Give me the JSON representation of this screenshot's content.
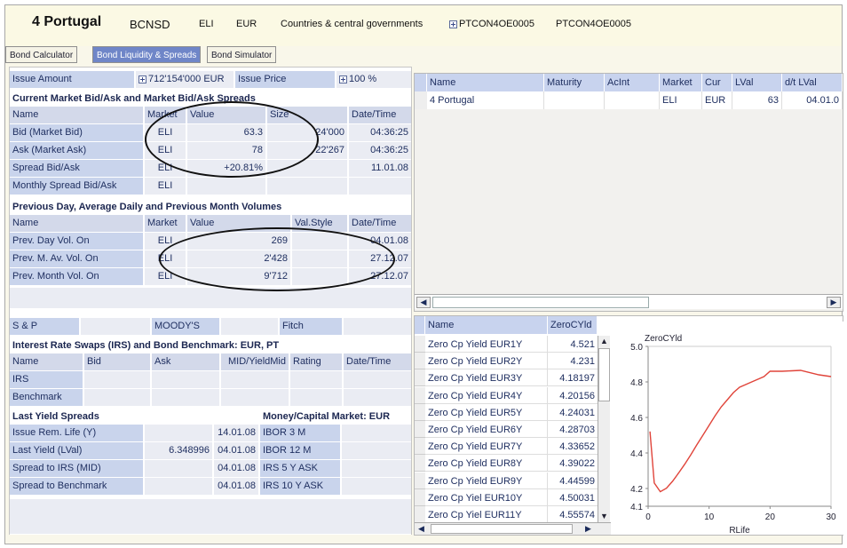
{
  "header": {
    "name": "4 Portugal",
    "issuer_code": "BCNSD",
    "market": "ELI",
    "currency": "EUR",
    "sector": "Countries & central governments",
    "isin1": "PTCON4OE0005",
    "isin2": "PTCON4OE0005"
  },
  "tabs": [
    "Bond Calculator",
    "Bond Liquidity & Spreads",
    "Bond Simulator"
  ],
  "issue": {
    "amount_label": "Issue Amount",
    "amount_value": "712'154'000 EUR",
    "price_label": "Issue Price",
    "price_value": "100 %"
  },
  "bidask": {
    "title": "Current Market Bid/Ask and Market Bid/Ask Spreads",
    "headers": [
      "Name",
      "Market",
      "Value",
      "Size",
      "Date/Time"
    ],
    "rows": [
      {
        "name": "Bid (Market Bid)",
        "market": "ELI",
        "value": "63.3",
        "size": "24'000",
        "time": "04:36:25"
      },
      {
        "name": "Ask (Market Ask)",
        "market": "ELI",
        "value": "78",
        "size": "22'267",
        "time": "04:36:25"
      },
      {
        "name": "Spread Bid/Ask",
        "market": "ELI",
        "value": "+20.81%",
        "size": "",
        "time": "11.01.08"
      },
      {
        "name": "Monthly Spread Bid/Ask",
        "market": "ELI",
        "value": "",
        "size": "",
        "time": ""
      }
    ]
  },
  "volumes": {
    "title": "Previous Day, Average Daily and Previous Month Volumes",
    "headers": [
      "Name",
      "Market",
      "Value",
      "Val.Style",
      "Date/Time"
    ],
    "rows": [
      {
        "name": "Prev. Day Vol. On",
        "market": "ELI",
        "value": "269",
        "time": "04.01.08"
      },
      {
        "name": "Prev. M. Av. Vol. On",
        "market": "ELI",
        "value": "2'428",
        "time": "27.12.07"
      },
      {
        "name": "Prev. Month Vol. On",
        "market": "ELI",
        "value": "9'712",
        "time": "27.12.07"
      }
    ]
  },
  "ratings": {
    "sp": "S & P",
    "moodys": "MOODY'S",
    "fitch": "Fitch"
  },
  "irs": {
    "title": "Interest Rate Swaps (IRS) and Bond Benchmark: EUR, PT",
    "headers": [
      "Name",
      "Bid",
      "Ask",
      "MID/YieldMid",
      "Rating",
      "Date/Time"
    ],
    "rows": [
      "IRS",
      "Benchmark"
    ]
  },
  "yields": {
    "title": "Last Yield Spreads",
    "mm_title": "Money/Capital Market: EUR",
    "rows": [
      {
        "name": "Issue Rem. Life (Y)",
        "value": "",
        "date": "14.01.08",
        "mm": "IBOR 3 M"
      },
      {
        "name": "Last Yield (LVal)",
        "value": "6.348996",
        "date": "04.01.08",
        "mm": "IBOR 12 M"
      },
      {
        "name": "Spread to IRS (MID)",
        "value": "",
        "date": "04.01.08",
        "mm": "IRS 5 Y ASK"
      },
      {
        "name": "Spread to Benchmark",
        "value": "",
        "date": "04.01.08",
        "mm": "IRS 10 Y ASK"
      }
    ]
  },
  "grid_top": {
    "headers": [
      "Name",
      "Maturity",
      "AcInt",
      "Market",
      "Cur",
      "LVal",
      "d/t LVal"
    ],
    "row": {
      "name": "4 Portugal",
      "maturity": "",
      "acint": "",
      "market": "ELI",
      "cur": "EUR",
      "lval": "63",
      "dt": "04.01.0"
    }
  },
  "grid_yield": {
    "headers": [
      "Name",
      "ZeroCYld"
    ],
    "rows": [
      {
        "name": "Zero Cp Yield EUR1Y",
        "value": "4.521"
      },
      {
        "name": "Zero Cp Yield EUR2Y",
        "value": "4.231"
      },
      {
        "name": "Zero Cp Yield EUR3Y",
        "value": "4.18197"
      },
      {
        "name": "Zero Cp Yield EUR4Y",
        "value": "4.20156"
      },
      {
        "name": "Zero Cp Yield EUR5Y",
        "value": "4.24031"
      },
      {
        "name": "Zero Cp Yield EUR6Y",
        "value": "4.28703"
      },
      {
        "name": "Zero Cp Yield EUR7Y",
        "value": "4.33652"
      },
      {
        "name": "Zero Cp Yield EUR8Y",
        "value": "4.39022"
      },
      {
        "name": "Zero Cp Yield EUR9Y",
        "value": "4.44599"
      },
      {
        "name": "Zero Cp Yiel EUR10Y",
        "value": "4.50031"
      },
      {
        "name": "Zero Cp Yiel EUR11Y",
        "value": "4.55574"
      }
    ]
  },
  "chart_data": {
    "type": "line",
    "title": "ZeroCYld",
    "xlabel": "RLife",
    "ylabel": "",
    "xlim": [
      0,
      30
    ],
    "ylim": [
      4.1,
      5.0
    ],
    "xticks": [
      "0",
      "10",
      "20",
      "30"
    ],
    "yticks": [
      "4.1",
      "4.2",
      "4.4",
      "4.6",
      "4.8",
      "5.0"
    ],
    "series": [
      {
        "x": [
          0.3,
          1.0,
          2.0,
          3.0,
          4.0,
          5.0,
          6.0,
          7.0,
          8.0,
          9.0,
          10.0,
          11.0,
          12.0,
          13.0,
          14.0,
          15.0,
          17.0,
          19.0,
          20.0,
          22.0,
          25.0,
          28.0,
          30.0
        ],
        "y": [
          4.521,
          4.231,
          4.18197,
          4.20156,
          4.24031,
          4.28703,
          4.33652,
          4.39022,
          4.44599,
          4.50031,
          4.55574,
          4.61,
          4.66,
          4.7,
          4.74,
          4.77,
          4.8,
          4.83,
          4.86,
          4.86,
          4.865,
          4.84,
          4.83
        ],
        "color": "#e0443a"
      }
    ]
  }
}
